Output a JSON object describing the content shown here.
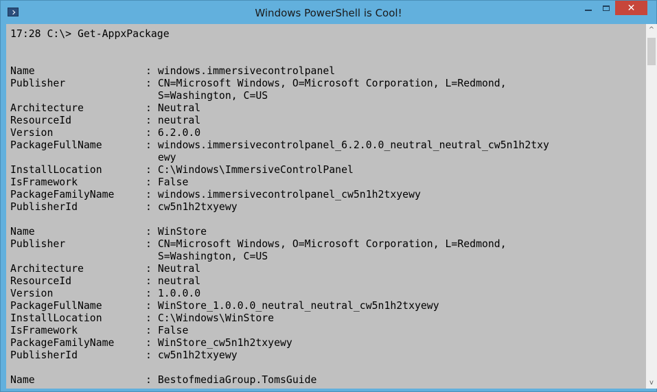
{
  "window": {
    "title": "Windows PowerShell is Cool!",
    "close_glyph": "✕"
  },
  "console": {
    "prompt": "17:28 C:\\> Get-AppxPackage",
    "packages": [
      {
        "name": "windows.immersivecontrolpanel",
        "publisher_1": "CN=Microsoft Windows, O=Microsoft Corporation, L=Redmond,",
        "publisher_2": "S=Washington, C=US",
        "architecture": "Neutral",
        "resource_id": "neutral",
        "version": "6.2.0.0",
        "package_full_name_1": "windows.immersivecontrolpanel_6.2.0.0_neutral_neutral_cw5n1h2txy",
        "package_full_name_2": "ewy",
        "install_location": "C:\\Windows\\ImmersiveControlPanel",
        "is_framework": "False",
        "package_family_name": "windows.immersivecontrolpanel_cw5n1h2txyewy",
        "publisher_id": "cw5n1h2txyewy"
      },
      {
        "name": "WinStore",
        "publisher_1": "CN=Microsoft Windows, O=Microsoft Corporation, L=Redmond,",
        "publisher_2": "S=Washington, C=US",
        "architecture": "Neutral",
        "resource_id": "neutral",
        "version": "1.0.0.0",
        "package_full_name_1": "WinStore_1.0.0.0_neutral_neutral_cw5n1h2txyewy",
        "install_location": "C:\\Windows\\WinStore",
        "is_framework": "False",
        "package_family_name": "WinStore_cw5n1h2txyewy",
        "publisher_id": "cw5n1h2txyewy"
      },
      {
        "name": "BestofmediaGroup.TomsGuide"
      }
    ],
    "labels": {
      "name": "Name",
      "publisher": "Publisher",
      "architecture": "Architecture",
      "resource_id": "ResourceId",
      "version": "Version",
      "package_full_name": "PackageFullName",
      "install_location": "InstallLocation",
      "is_framework": "IsFramework",
      "package_family_name": "PackageFamilyName",
      "publisher_id": "PublisherId"
    },
    "separator": ": ",
    "indent": "  "
  },
  "scrollbar": {
    "up_glyph": "^",
    "down_glyph": "v"
  }
}
